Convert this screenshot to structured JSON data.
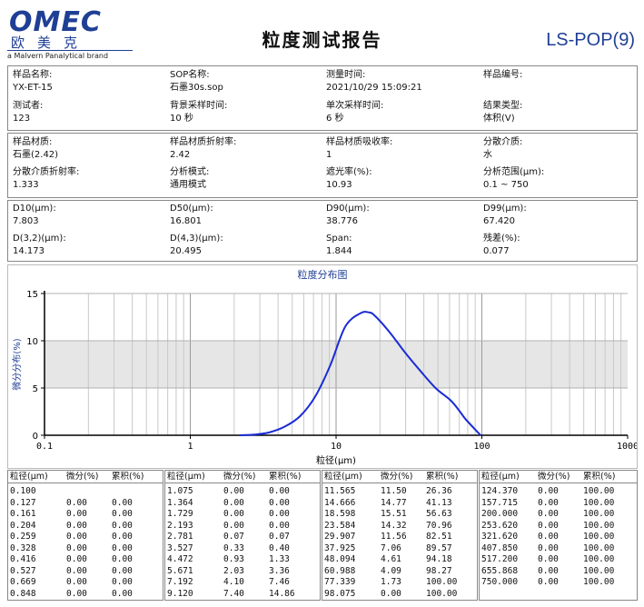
{
  "header": {
    "logo_word": "OMEC",
    "logo_cn": "欧美克",
    "logo_brand": "a Malvern Panalytical brand",
    "title": "粒度测试报告",
    "model": "LS-POP(9)"
  },
  "info": [
    [
      {
        "label": "样品名称:",
        "value": "YX-ET-15"
      },
      {
        "label": "SOP名称:",
        "value": "石墨30s.sop"
      },
      {
        "label": "测量时间:",
        "value": "2021/10/29 15:09:21"
      },
      {
        "label": "样品编号:",
        "value": ""
      }
    ],
    [
      {
        "label": "测试者:",
        "value": "123"
      },
      {
        "label": "背景采样时间:",
        "value": "10 秒"
      },
      {
        "label": "单次采样时间:",
        "value": "6 秒"
      },
      {
        "label": "结果类型:",
        "value": "体积(V)"
      }
    ]
  ],
  "material": [
    [
      {
        "label": "样品材质:",
        "value": "石墨(2.42)"
      },
      {
        "label": "样品材质折射率:",
        "value": "2.42"
      },
      {
        "label": "样品材质吸收率:",
        "value": "1"
      },
      {
        "label": "分散介质:",
        "value": "水"
      }
    ],
    [
      {
        "label": "分散介质折射率:",
        "value": "1.333"
      },
      {
        "label": "分析模式:",
        "value": "通用模式"
      },
      {
        "label": "遮光率(%):",
        "value": "10.93"
      },
      {
        "label": "分析范围(μm):",
        "value": "0.1 ~ 750"
      }
    ]
  ],
  "results": [
    [
      {
        "label": "D10(μm):",
        "value": "7.803"
      },
      {
        "label": "D50(μm):",
        "value": "16.801"
      },
      {
        "label": "D90(μm):",
        "value": "38.776"
      },
      {
        "label": "D99(μm):",
        "value": "67.420"
      }
    ],
    [
      {
        "label": "D(3,2)(μm):",
        "value": "14.173"
      },
      {
        "label": "D(4,3)(μm):",
        "value": "20.495"
      },
      {
        "label": "Span:",
        "value": "1.844"
      },
      {
        "label": "残差(%):",
        "value": "0.077"
      }
    ]
  ],
  "chart_data": {
    "type": "line",
    "title": "粒度分布图",
    "xlabel": "粒径(μm)",
    "ylabel": "微分分布(%)",
    "x_scale": "log",
    "xlim": [
      0.1,
      1000
    ],
    "ylim": [
      0,
      15
    ],
    "x_ticks": [
      0.1,
      1,
      10,
      100,
      1000
    ],
    "x_tick_labels": [
      "0.1",
      "1",
      "10",
      "100",
      "1000"
    ],
    "y_ticks": [
      0,
      5,
      10,
      15
    ],
    "shaded_band": [
      5,
      10
    ],
    "grid": true,
    "series": [
      {
        "values": [
          [
            2.193,
            0.0
          ],
          [
            2.781,
            0.07
          ],
          [
            3.527,
            0.33
          ],
          [
            4.472,
            0.93
          ],
          [
            5.671,
            2.03
          ],
          [
            7.192,
            4.1
          ],
          [
            9.12,
            7.4
          ],
          [
            11.565,
            11.5
          ],
          [
            14.666,
            12.9
          ],
          [
            16.8,
            13.0
          ],
          [
            18.598,
            12.6
          ],
          [
            23.584,
            10.8
          ],
          [
            29.907,
            8.7
          ],
          [
            37.925,
            6.8
          ],
          [
            48.094,
            5.0
          ],
          [
            60.988,
            3.7
          ],
          [
            70.0,
            2.6
          ],
          [
            77.339,
            1.7
          ],
          [
            98.075,
            0.0
          ]
        ]
      }
    ]
  },
  "table": {
    "headers": [
      "粒径(μm)",
      "微分(%)",
      "累积(%)"
    ],
    "columns": [
      [
        [
          "0.100",
          "",
          ""
        ],
        [
          "0.127",
          "0.00",
          "0.00"
        ],
        [
          "0.161",
          "0.00",
          "0.00"
        ],
        [
          "0.204",
          "0.00",
          "0.00"
        ],
        [
          "0.259",
          "0.00",
          "0.00"
        ],
        [
          "0.328",
          "0.00",
          "0.00"
        ],
        [
          "0.416",
          "0.00",
          "0.00"
        ],
        [
          "0.527",
          "0.00",
          "0.00"
        ],
        [
          "0.669",
          "0.00",
          "0.00"
        ],
        [
          "0.848",
          "0.00",
          "0.00"
        ]
      ],
      [
        [
          "1.075",
          "0.00",
          "0.00"
        ],
        [
          "1.364",
          "0.00",
          "0.00"
        ],
        [
          "1.729",
          "0.00",
          "0.00"
        ],
        [
          "2.193",
          "0.00",
          "0.00"
        ],
        [
          "2.781",
          "0.07",
          "0.07"
        ],
        [
          "3.527",
          "0.33",
          "0.40"
        ],
        [
          "4.472",
          "0.93",
          "1.33"
        ],
        [
          "5.671",
          "2.03",
          "3.36"
        ],
        [
          "7.192",
          "4.10",
          "7.46"
        ],
        [
          "9.120",
          "7.40",
          "14.86"
        ]
      ],
      [
        [
          "11.565",
          "11.50",
          "26.36"
        ],
        [
          "14.666",
          "14.77",
          "41.13"
        ],
        [
          "18.598",
          "15.51",
          "56.63"
        ],
        [
          "23.584",
          "14.32",
          "70.96"
        ],
        [
          "29.907",
          "11.56",
          "82.51"
        ],
        [
          "37.925",
          "7.06",
          "89.57"
        ],
        [
          "48.094",
          "4.61",
          "94.18"
        ],
        [
          "60.988",
          "4.09",
          "98.27"
        ],
        [
          "77.339",
          "1.73",
          "100.00"
        ],
        [
          "98.075",
          "0.00",
          "100.00"
        ]
      ],
      [
        [
          "124.370",
          "0.00",
          "100.00"
        ],
        [
          "157.715",
          "0.00",
          "100.00"
        ],
        [
          "200.000",
          "0.00",
          "100.00"
        ],
        [
          "253.620",
          "0.00",
          "100.00"
        ],
        [
          "321.620",
          "0.00",
          "100.00"
        ],
        [
          "407.850",
          "0.00",
          "100.00"
        ],
        [
          "517.200",
          "0.00",
          "100.00"
        ],
        [
          "655.868",
          "0.00",
          "100.00"
        ],
        [
          "750.000",
          "0.00",
          "100.00"
        ],
        [
          "",
          "",
          ""
        ]
      ]
    ]
  }
}
